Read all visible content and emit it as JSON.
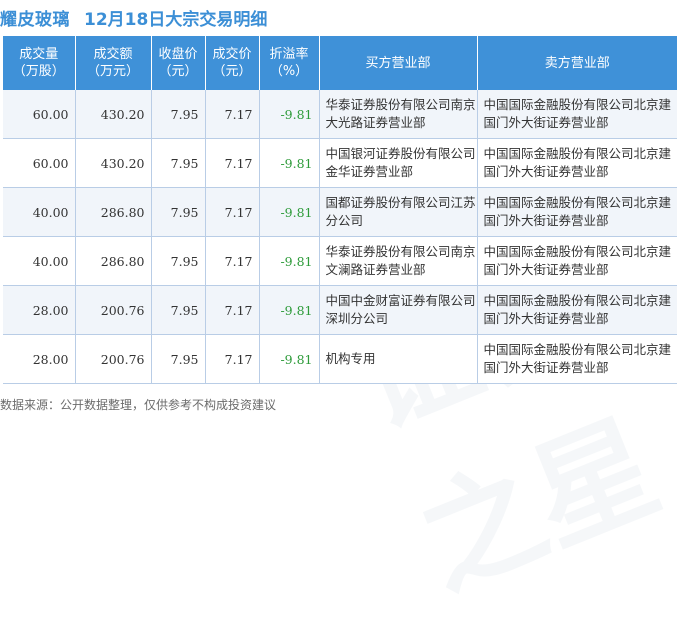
{
  "title": {
    "stock": "耀皮玻璃",
    "subtitle": "12月18日大宗交易明细"
  },
  "table": {
    "headers": [
      "成交量\n（万股）",
      "成交额\n（万元）",
      "收盘价\n（元）",
      "成交价\n（元）",
      "折溢率\n（%）",
      "买方营业部",
      "卖方营业部"
    ],
    "rows": [
      [
        "60.00",
        "430.20",
        "7.95",
        "7.17",
        "-9.81",
        "华泰证券股份有限公司南京大光路证券营业部",
        "中国国际金融股份有限公司北京建国门外大街证券营业部"
      ],
      [
        "60.00",
        "430.20",
        "7.95",
        "7.17",
        "-9.81",
        "中国银河证券股份有限公司金华证券营业部",
        "中国国际金融股份有限公司北京建国门外大街证券营业部"
      ],
      [
        "40.00",
        "286.80",
        "7.95",
        "7.17",
        "-9.81",
        "国都证券股份有限公司江苏分公司",
        "中国国际金融股份有限公司北京建国门外大街证券营业部"
      ],
      [
        "40.00",
        "286.80",
        "7.95",
        "7.17",
        "-9.81",
        "华泰证券股份有限公司南京文澜路证券营业部",
        "中国国际金融股份有限公司北京建国门外大街证券营业部"
      ],
      [
        "28.00",
        "200.76",
        "7.95",
        "7.17",
        "-9.81",
        "中国中金财富证券有限公司深圳分公司",
        "中国国际金融股份有限公司北京建国门外大街证券营业部"
      ],
      [
        "28.00",
        "200.76",
        "7.95",
        "7.17",
        "-9.81",
        "机构专用",
        "中国国际金融股份有限公司北京建国门外大街证券营业部"
      ]
    ]
  },
  "footer": "数据来源：公开数据整理，仅供参考不构成投资建议",
  "colors": {
    "header_bg": "#3f91d8",
    "title": "#3c8fd6",
    "negative": "#2e9b3a"
  }
}
